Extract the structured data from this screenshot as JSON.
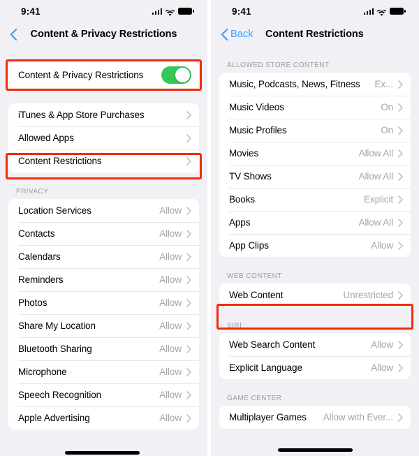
{
  "left": {
    "status": {
      "time": "9:41",
      "cellular_icon": "cellular-bars-icon",
      "wifi_icon": "wifi-icon",
      "battery_icon": "battery-full-icon"
    },
    "nav": {
      "title": "Content & Privacy Restrictions",
      "back_icon": "chevron-left-icon",
      "back_label": ""
    },
    "toggle_row": {
      "label": "Content & Privacy Restrictions",
      "state": "on",
      "accent": "#34c759",
      "highlighted": true
    },
    "groups": [
      {
        "header": "",
        "rows": [
          {
            "label": "iTunes & App Store Purchases",
            "value": "",
            "highlighted": false
          },
          {
            "label": "Allowed Apps",
            "value": "",
            "highlighted": false
          },
          {
            "label": "Content Restrictions",
            "value": "",
            "highlighted": true
          }
        ]
      },
      {
        "header": "PRIVACY",
        "rows": [
          {
            "label": "Location Services",
            "value": "Allow",
            "highlighted": false
          },
          {
            "label": "Contacts",
            "value": "Allow",
            "highlighted": false
          },
          {
            "label": "Calendars",
            "value": "Allow",
            "highlighted": false
          },
          {
            "label": "Reminders",
            "value": "Allow",
            "highlighted": false
          },
          {
            "label": "Photos",
            "value": "Allow",
            "highlighted": false
          },
          {
            "label": "Share My Location",
            "value": "Allow",
            "highlighted": false
          },
          {
            "label": "Bluetooth Sharing",
            "value": "Allow",
            "highlighted": false
          },
          {
            "label": "Microphone",
            "value": "Allow",
            "highlighted": false
          },
          {
            "label": "Speech Recognition",
            "value": "Allow",
            "highlighted": false
          },
          {
            "label": "Apple Advertising",
            "value": "Allow",
            "highlighted": false
          }
        ]
      }
    ]
  },
  "right": {
    "status": {
      "time": "9:41",
      "cellular_icon": "cellular-bars-icon",
      "wifi_icon": "wifi-icon",
      "battery_icon": "battery-full-icon"
    },
    "nav": {
      "title": "Content Restrictions",
      "back_icon": "chevron-left-icon",
      "back_label": "Back"
    },
    "groups": [
      {
        "header": "ALLOWED STORE CONTENT",
        "rows": [
          {
            "label": "Music, Podcasts, News, Fitness",
            "value": "Ex...",
            "highlighted": false
          },
          {
            "label": "Music Videos",
            "value": "On",
            "highlighted": false
          },
          {
            "label": "Music Profiles",
            "value": "On",
            "highlighted": false
          },
          {
            "label": "Movies",
            "value": "Allow All",
            "highlighted": false
          },
          {
            "label": "TV Shows",
            "value": "Allow All",
            "highlighted": false
          },
          {
            "label": "Books",
            "value": "Explicit",
            "highlighted": false
          },
          {
            "label": "Apps",
            "value": "Allow All",
            "highlighted": false
          },
          {
            "label": "App Clips",
            "value": "Allow",
            "highlighted": false
          }
        ]
      },
      {
        "header": "WEB CONTENT",
        "rows": [
          {
            "label": "Web Content",
            "value": "Unrestricted",
            "highlighted": true
          }
        ]
      },
      {
        "header": "SIRI",
        "rows": [
          {
            "label": "Web Search Content",
            "value": "Allow",
            "highlighted": false
          },
          {
            "label": "Explicit Language",
            "value": "Allow",
            "highlighted": false
          }
        ]
      },
      {
        "header": "GAME CENTER",
        "rows": [
          {
            "label": "Multiplayer Games",
            "value": "Allow with Ever...",
            "highlighted": false
          }
        ]
      }
    ]
  },
  "theme": {
    "highlight_color": "#f62b07",
    "accent_blue": "#3b9dfb",
    "toggle_green": "#34c759",
    "page_bg": "#f1f1f5",
    "card_bg": "#ffffff",
    "value_gray": "#a4a4ab",
    "header_gray": "#9b9ba2"
  }
}
